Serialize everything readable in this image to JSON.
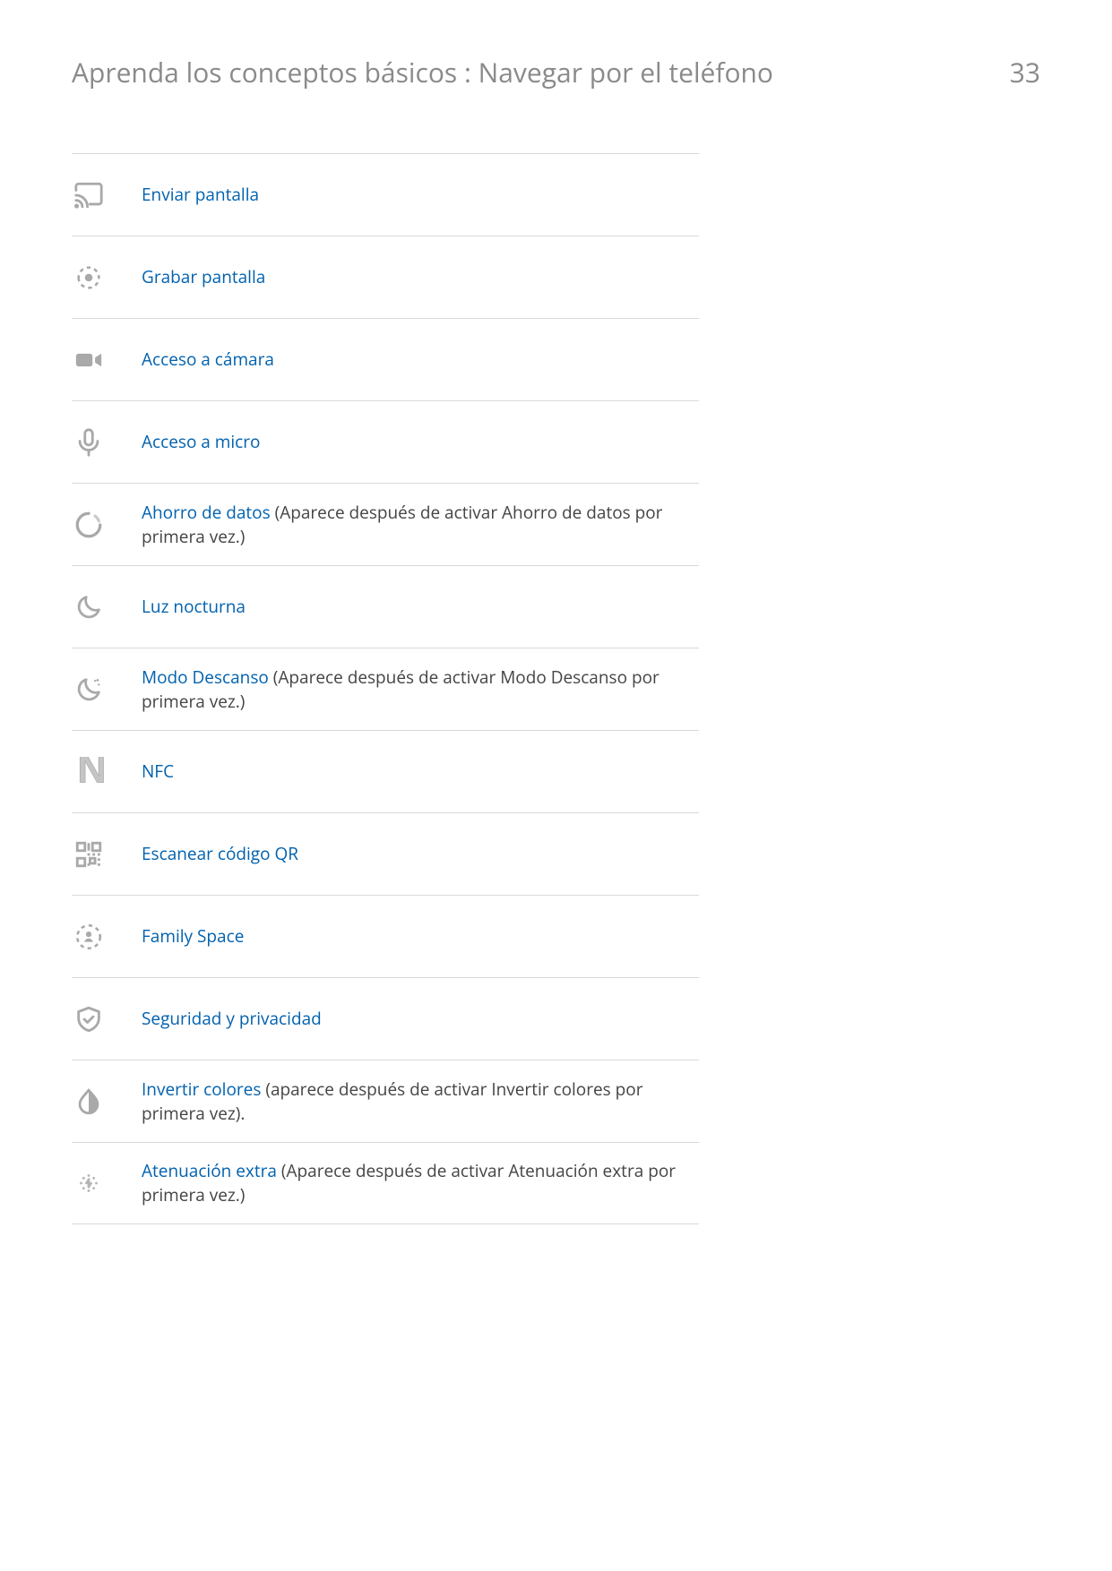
{
  "header": {
    "title": "Aprenda los conceptos básicos : Navegar por el teléfono",
    "page_number": "33"
  },
  "rows": [
    {
      "icon": "cast-icon",
      "link": "Enviar pantalla",
      "tail": ""
    },
    {
      "icon": "record-icon",
      "link": "Grabar pantalla",
      "tail": ""
    },
    {
      "icon": "camera-icon",
      "link": "Acceso a cámara",
      "tail": ""
    },
    {
      "icon": "mic-icon",
      "link": "Acceso a micro",
      "tail": ""
    },
    {
      "icon": "data-saver-icon",
      "link": "Ahorro de datos",
      "tail": " (Aparece después de activar Ahorro de datos por primera vez.)"
    },
    {
      "icon": "moon-icon",
      "link": "Luz nocturna",
      "tail": ""
    },
    {
      "icon": "bedtime-icon",
      "link": "Modo Descanso",
      "tail": " (Aparece después de activar Modo Descanso por primera vez.)"
    },
    {
      "icon": "nfc-icon",
      "link": "NFC",
      "tail": ""
    },
    {
      "icon": "qr-icon",
      "link": "Escanear código QR",
      "tail": ""
    },
    {
      "icon": "family-space-icon",
      "link": "Family Space",
      "tail": ""
    },
    {
      "icon": "shield-check-icon",
      "link": "Seguridad y privacidad",
      "tail": ""
    },
    {
      "icon": "invert-colors-icon",
      "link": "Invertir colores",
      "tail": " (aparece después de activar Invertir colores por primera vez)."
    },
    {
      "icon": "extra-dim-icon",
      "link": "Atenuación extra",
      "tail": " (Aparece después de activar Atenuación extra por primera vez.)"
    }
  ]
}
